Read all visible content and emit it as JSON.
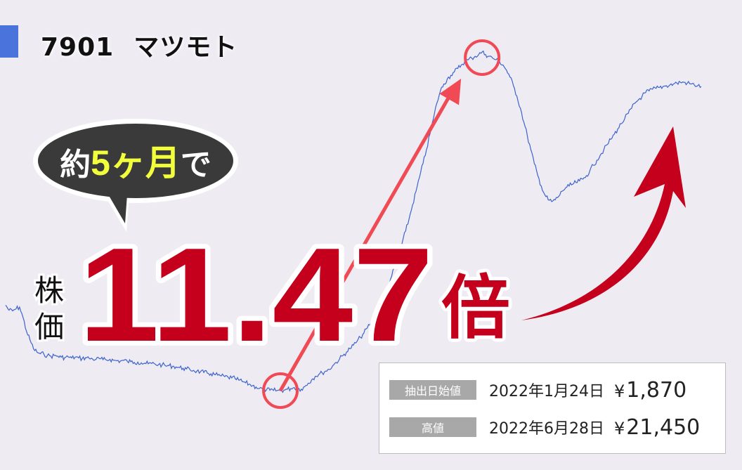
{
  "header": {
    "code": "7901",
    "name": "マツモト"
  },
  "bubble": {
    "prefix": "約",
    "highlight": "5ヶ月",
    "suffix": "で"
  },
  "headline": {
    "label_top": "株",
    "label_bottom": "価",
    "multiple": "11.47",
    "unit": "倍"
  },
  "info": {
    "rows": [
      {
        "tag": "抽出日始値",
        "date": "2022年1月24日",
        "currency": "¥",
        "price": "1,870"
      },
      {
        "tag": "高値",
        "date": "2022年6月28日",
        "currency": "¥",
        "price": "21,450"
      }
    ]
  },
  "colors": {
    "line": "#3d63cc",
    "accent_red": "#c4001c",
    "arrow_red": "#f04a55",
    "highlight_yellow": "#f2ff3c",
    "bubble_dark": "#3a3a3a",
    "title_bar": "#4a73dc"
  },
  "chart_data": {
    "type": "line",
    "title": "",
    "xlabel": "",
    "ylabel": "",
    "start_date": "2022-01-24",
    "start_price": 1870,
    "peak_date": "2022-06-28",
    "peak_price": 21450,
    "ylim": [
      0,
      25000
    ],
    "grid": false,
    "series": [
      {
        "name": "",
        "t": [
          0,
          1,
          2,
          3,
          4,
          5,
          6,
          7,
          8,
          9,
          10,
          11,
          12,
          13,
          14,
          15,
          16,
          17,
          18,
          19,
          20,
          21,
          22,
          23,
          24,
          25,
          26,
          27,
          28,
          29,
          30,
          31,
          32,
          33,
          34,
          35,
          36,
          37,
          38,
          39,
          40,
          41,
          42,
          43,
          44,
          45,
          46,
          47,
          48,
          49,
          50,
          51,
          52,
          53,
          54,
          55,
          56,
          57,
          58,
          59,
          60,
          61,
          62,
          63,
          64,
          65,
          66,
          67,
          68,
          69,
          70,
          71,
          72,
          73,
          74,
          75,
          76,
          77,
          78,
          79,
          80,
          81,
          82,
          83,
          84,
          85,
          86,
          87,
          88,
          89,
          90,
          91,
          92,
          93,
          94,
          95,
          96,
          97,
          98,
          99,
          100,
          101,
          102,
          103,
          104,
          105,
          106,
          107,
          108,
          109,
          110,
          111,
          112,
          113,
          114,
          115,
          116,
          117,
          118,
          119,
          120,
          121,
          122,
          123,
          124,
          125,
          126,
          127,
          128,
          129,
          130,
          131,
          132,
          133,
          134,
          135,
          136,
          137,
          138,
          139,
          140,
          141,
          142,
          143,
          144,
          145,
          146,
          147,
          148,
          149,
          150,
          151,
          152,
          153,
          154,
          155,
          156,
          157,
          158,
          159,
          160,
          161,
          162,
          163,
          164,
          165,
          166,
          167,
          168,
          169,
          170,
          171,
          172,
          173,
          174,
          175,
          176,
          177,
          178,
          179,
          180,
          181,
          182,
          183,
          184,
          185,
          186,
          187,
          188,
          189,
          190,
          191,
          192,
          193,
          194,
          195,
          196,
          197,
          198,
          199,
          200
        ],
        "values": [
          6810,
          6520,
          6480,
          6600,
          6700,
          6100,
          5300,
          4800,
          4300,
          4100,
          4000,
          3980,
          3900,
          3860,
          3900,
          3860,
          3800,
          3780,
          3820,
          3760,
          3800,
          3760,
          3720,
          3780,
          3740,
          3700,
          3680,
          3720,
          3660,
          3640,
          3680,
          3620,
          3600,
          3580,
          3620,
          3560,
          3540,
          3500,
          3520,
          3480,
          3460,
          3420,
          3440,
          3400,
          3380,
          3360,
          3300,
          3320,
          3280,
          3240,
          3200,
          3160,
          3120,
          3080,
          3040,
          3000,
          2960,
          2920,
          2880,
          2840,
          2800,
          2760,
          2720,
          2680,
          2640,
          2600,
          2560,
          2480,
          2400,
          2320,
          2240,
          2160,
          2080,
          2000,
          1960,
          1920,
          1890,
          1880,
          1875,
          1870,
          1900,
          1950,
          1990,
          2050,
          2000,
          1950,
          2100,
          2300,
          2500,
          2700,
          2800,
          2900,
          3000,
          3100,
          3300,
          3500,
          3700,
          3900,
          4100,
          4300,
          4500,
          4700,
          4950,
          5200,
          5500,
          5800,
          6200,
          6600,
          7000,
          7500,
          8000,
          8500,
          9100,
          9700,
          10400,
          11100,
          11800,
          12600,
          13400,
          14200,
          15000,
          15800,
          16700,
          17600,
          18500,
          19200,
          19600,
          19900,
          20100,
          20300,
          20500,
          20700,
          20900,
          21000,
          21100,
          21200,
          21300,
          21450,
          21300,
          21200,
          21100,
          21000,
          20900,
          20700,
          20400,
          20000,
          19500,
          18900,
          18200,
          17400,
          16600,
          15800,
          15000,
          14300,
          13700,
          13200,
          12900,
          12800,
          12900,
          13100,
          13400,
          13600,
          13700,
          13800,
          13900,
          14000,
          14100,
          14300,
          14600,
          14900,
          15200,
          15500,
          15800,
          16100,
          16400,
          16700,
          17000,
          17300,
          17600,
          17900,
          18200,
          18500,
          18700,
          18900,
          19100,
          19200,
          19300,
          19350,
          19400,
          19450,
          19500,
          19550,
          19600,
          19650,
          19700,
          19700,
          19650,
          19600,
          19550,
          19500,
          19450
        ]
      }
    ]
  }
}
